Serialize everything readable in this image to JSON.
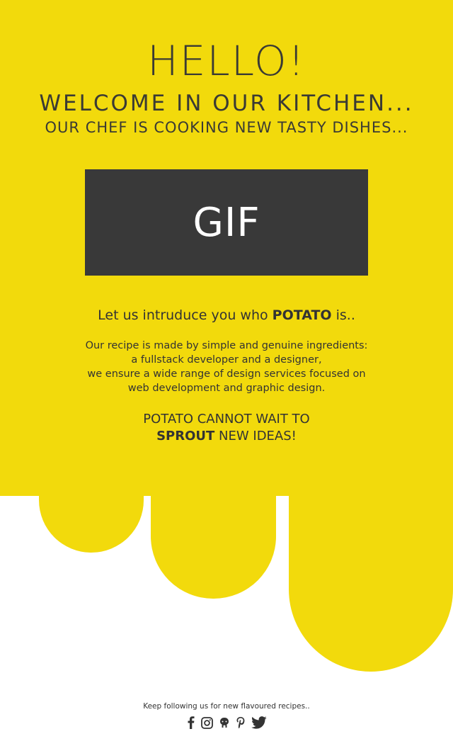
{
  "header": {
    "title": "HELLO!",
    "welcome": "WELCOME IN OUR KITCHEN...",
    "chef": "OUR CHEF IS COOKING NEW TASTY DISHES..."
  },
  "media": {
    "gif_label": "GIF"
  },
  "intro": {
    "prefix": "Let us intruduce you who ",
    "brand": "POTATO",
    "suffix": " is.."
  },
  "description": {
    "line1": "Our recipe is made by simple and genuine ingredients:",
    "line2": "a fullstack developer and a designer,",
    "line3": "we ensure a wide range of design services focused on",
    "line4": "web development and graphic design."
  },
  "tagline": {
    "line1": "POTATO CANNOT WAIT TO",
    "bold": "SPROUT",
    "rest": " NEW IDEAS!"
  },
  "footer": {
    "text": "Keep following us for new flavoured recipes..",
    "social": [
      "facebook-icon",
      "instagram-icon",
      "github-icon",
      "pinterest-icon",
      "twitter-icon"
    ]
  },
  "colors": {
    "background_yellow": "#f2da0c",
    "dark": "#393939",
    "text": "#333333"
  }
}
